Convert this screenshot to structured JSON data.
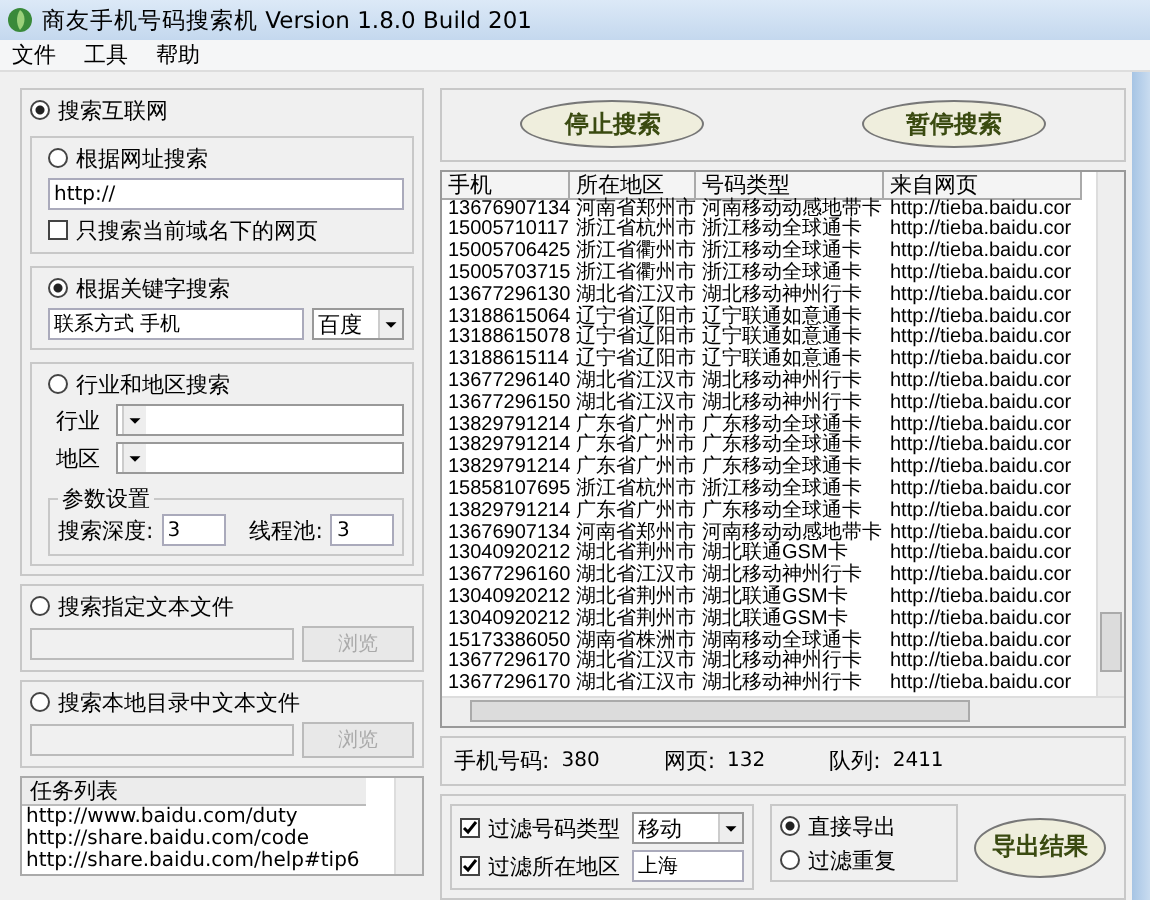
{
  "window": {
    "title": "商友手机号码搜索机 Version 1.8.0 Build 201"
  },
  "menu": [
    "文件",
    "工具",
    "帮助"
  ],
  "search_internet": {
    "label": "搜索互联网",
    "selected": true,
    "url_search": {
      "label": "根据网址搜索",
      "selected": false,
      "url": "http://",
      "domain_only": {
        "label": "只搜索当前域名下的网页",
        "checked": false
      }
    },
    "keyword_search": {
      "label": "根据关键字搜索",
      "selected": true,
      "keyword": "联系方式 手机",
      "engine": "百度"
    },
    "region_search": {
      "label": "行业和地区搜索",
      "selected": false,
      "industry_label": "行业",
      "region_label": "地区"
    },
    "params": {
      "title": "参数设置",
      "depth_label": "搜索深度:",
      "depth": "3",
      "threads_label": "线程池:",
      "threads": "3"
    }
  },
  "text_file": {
    "label": "搜索指定文本文件",
    "selected": false,
    "browse": "浏览",
    "disabled": true
  },
  "local_dir": {
    "label": "搜索本地目录中文本文件",
    "selected": false,
    "browse": "浏览",
    "disabled": true
  },
  "task_list": {
    "title": "任务列表",
    "items": [
      "http://www.baidu.com/duty",
      "http://share.baidu.com/code",
      "http://share.baidu.com/help#tip6"
    ]
  },
  "buttons": {
    "stop": "停止搜索",
    "pause": "暂停搜索"
  },
  "table": {
    "columns": [
      "手机",
      "所在地区",
      "号码类型",
      "来自网页"
    ],
    "rows": [
      [
        "13676907134",
        "河南省郑州市",
        "河南移动动感地带卡",
        "http://tieba.baidu.cor"
      ],
      [
        "15005710117",
        "浙江省杭州市",
        "浙江移动全球通卡",
        "http://tieba.baidu.cor"
      ],
      [
        "15005706425",
        "浙江省衢州市",
        "浙江移动全球通卡",
        "http://tieba.baidu.cor"
      ],
      [
        "15005703715",
        "浙江省衢州市",
        "浙江移动全球通卡",
        "http://tieba.baidu.cor"
      ],
      [
        "13677296130",
        "湖北省江汉市",
        "湖北移动神州行卡",
        "http://tieba.baidu.cor"
      ],
      [
        "13188615064",
        "辽宁省辽阳市",
        "辽宁联通如意通卡",
        "http://tieba.baidu.cor"
      ],
      [
        "13188615078",
        "辽宁省辽阳市",
        "辽宁联通如意通卡",
        "http://tieba.baidu.cor"
      ],
      [
        "13188615114",
        "辽宁省辽阳市",
        "辽宁联通如意通卡",
        "http://tieba.baidu.cor"
      ],
      [
        "13677296140",
        "湖北省江汉市",
        "湖北移动神州行卡",
        "http://tieba.baidu.cor"
      ],
      [
        "13677296150",
        "湖北省江汉市",
        "湖北移动神州行卡",
        "http://tieba.baidu.cor"
      ],
      [
        "13829791214",
        "广东省广州市",
        "广东移动全球通卡",
        "http://tieba.baidu.cor"
      ],
      [
        "13829791214",
        "广东省广州市",
        "广东移动全球通卡",
        "http://tieba.baidu.cor"
      ],
      [
        "13829791214",
        "广东省广州市",
        "广东移动全球通卡",
        "http://tieba.baidu.cor"
      ],
      [
        "15858107695",
        "浙江省杭州市",
        "浙江移动全球通卡",
        "http://tieba.baidu.cor"
      ],
      [
        "13829791214",
        "广东省广州市",
        "广东移动全球通卡",
        "http://tieba.baidu.cor"
      ],
      [
        "13676907134",
        "河南省郑州市",
        "河南移动动感地带卡",
        "http://tieba.baidu.cor"
      ],
      [
        "13040920212",
        "湖北省荆州市",
        "湖北联通GSM卡",
        "http://tieba.baidu.cor"
      ],
      [
        "13677296160",
        "湖北省江汉市",
        "湖北移动神州行卡",
        "http://tieba.baidu.cor"
      ],
      [
        "13040920212",
        "湖北省荆州市",
        "湖北联通GSM卡",
        "http://tieba.baidu.cor"
      ],
      [
        "13040920212",
        "湖北省荆州市",
        "湖北联通GSM卡",
        "http://tieba.baidu.cor"
      ],
      [
        "15173386050",
        "湖南省株洲市",
        "湖南移动全球通卡",
        "http://tieba.baidu.cor"
      ],
      [
        "13677296170",
        "湖北省江汉市",
        "湖北移动神州行卡",
        "http://tieba.baidu.cor"
      ],
      [
        "13677296170",
        "湖北省江汉市",
        "湖北移动神州行卡",
        "http://tieba.baidu.cor"
      ]
    ]
  },
  "stats": [
    {
      "label": "手机号码:",
      "value": "380"
    },
    {
      "label": "网页:",
      "value": "132"
    },
    {
      "label": "队列:",
      "value": "2411"
    }
  ],
  "filters": [
    {
      "kind": "dropdown",
      "label": "过滤号码类型",
      "checked": true,
      "value": "移动"
    },
    {
      "kind": "text",
      "label": "过滤所在地区",
      "checked": true,
      "value": "上海"
    }
  ],
  "export": {
    "options": [
      {
        "label": "直接导出",
        "selected": true
      },
      {
        "label": "过滤重复",
        "selected": false
      }
    ],
    "button": "导出结果"
  }
}
